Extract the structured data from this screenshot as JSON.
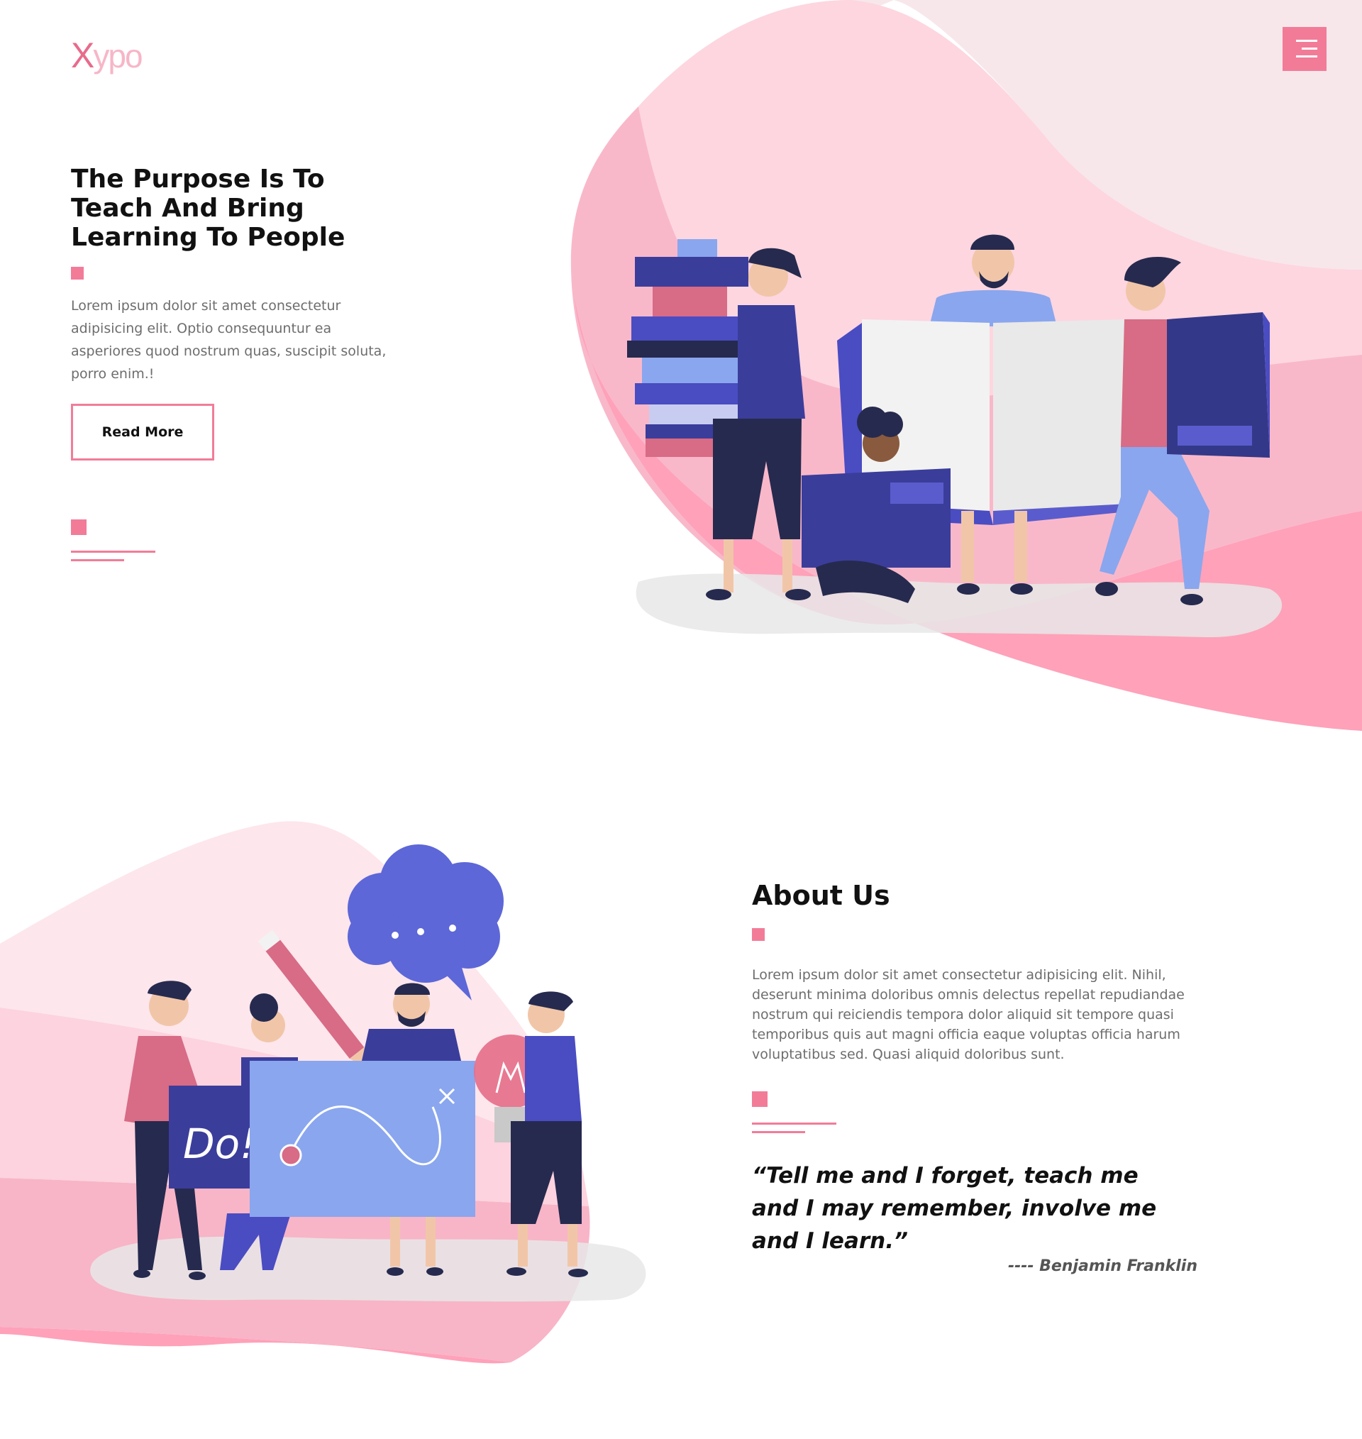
{
  "header": {
    "logo_x": "X",
    "logo_rest": "ypo",
    "menu_icon": "hamburger-menu-icon"
  },
  "hero": {
    "title": "The Purpose Is To Teach And Bring Learning To People",
    "text": "Lorem ipsum dolor sit amet consectetur adipisicing elit. Optio consequuntur ea asperiores quod nostrum quas, suscipit soluta, porro enim.!",
    "button_label": "Read More",
    "illustration": "people-with-books-illustration"
  },
  "about": {
    "title": "About Us",
    "text": "Lorem ipsum dolor sit amet consectetur adipisicing elit. Nihil, deserunt minima doloribus omnis delectus repellat repudiandae nostrum qui reiciendis tempora dolor aliquid sit tempore quasi temporibus quis aut magni officia eaque voluptas officia harum voluptatibus sed. Quasi aliquid doloribus sunt.",
    "quote": "“Tell me and I forget, teach me and I may remember, involve me and I learn.”",
    "quote_author": "---- Benjamin Franklin",
    "illustration": "team-brainstorm-illustration"
  },
  "colors": {
    "accent": "#f27c98",
    "blob_light": "#fde3ea",
    "blob_mid": "#fbc4d3",
    "blob_dark": "#f9a8c0",
    "indigo": "#3b3d9b",
    "periwinkle": "#8aa6ee",
    "navy": "#262a4e"
  }
}
